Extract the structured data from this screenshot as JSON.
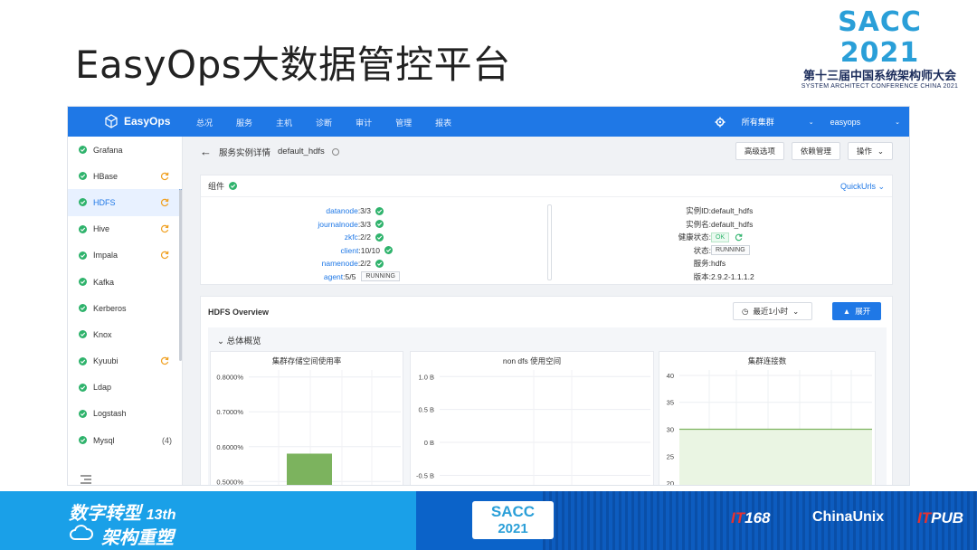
{
  "slide": {
    "title": "EasyOps大数据管控平台",
    "sacc_logo": {
      "main": "SACC 2021",
      "cn": "第十三届中国系统架构师大会",
      "en": "SYSTEM ARCHITECT CONFERENCE CHINA 2021"
    }
  },
  "topbar": {
    "brand": "EasyOps",
    "nav": [
      "总况",
      "服务",
      "主机",
      "诊断",
      "审计",
      "管理",
      "报表"
    ],
    "cluster_select": "所有集群",
    "user": "easyops",
    "color": "#1f78e6"
  },
  "sidebar": {
    "items": [
      {
        "label": "Grafana",
        "sync": false,
        "count": ""
      },
      {
        "label": "HBase",
        "sync": true,
        "count": ""
      },
      {
        "label": "HDFS",
        "sync": true,
        "count": "",
        "active": true
      },
      {
        "label": "Hive",
        "sync": true,
        "count": ""
      },
      {
        "label": "Impala",
        "sync": true,
        "count": ""
      },
      {
        "label": "Kafka",
        "sync": false,
        "count": ""
      },
      {
        "label": "Kerberos",
        "sync": false,
        "count": ""
      },
      {
        "label": "Knox",
        "sync": false,
        "count": ""
      },
      {
        "label": "Kyuubi",
        "sync": true,
        "count": ""
      },
      {
        "label": "Ldap",
        "sync": false,
        "count": ""
      },
      {
        "label": "Logstash",
        "sync": false,
        "count": ""
      },
      {
        "label": "Mysql",
        "sync": false,
        "count": "(4)"
      }
    ]
  },
  "header": {
    "breadcrumb_label": "服务实例详情",
    "instance": "default_hdfs",
    "buttons": {
      "advanced": "高级选项",
      "deps": "依赖管理",
      "ops": "操作"
    }
  },
  "components": {
    "title": "组件",
    "quickurls": "QuickUrls",
    "items": [
      {
        "name": "datanode",
        "value": ":3/3",
        "tag": ""
      },
      {
        "name": "journalnode",
        "value": ":3/3",
        "tag": ""
      },
      {
        "name": "zkfc",
        "value": ":2/2",
        "tag": ""
      },
      {
        "name": "client",
        "value": ":10/10",
        "tag": ""
      },
      {
        "name": "namenode",
        "value": ":2/2",
        "tag": ""
      },
      {
        "name": "agent",
        "value": ":5/5",
        "tag": "RUNNING"
      }
    ]
  },
  "instance_info": {
    "id_label": "实例ID:",
    "id_value": "default_hdfs",
    "name_label": "实例名:",
    "name_value": "default_hdfs",
    "health_label": "健康状态:",
    "health_value": "OK",
    "state_label": "状态:",
    "state_value": "RUNNING",
    "service_label": "服务:",
    "service_value": "hdfs",
    "version_label": "版本:",
    "version_value": "2.9.2-1.1.1.2"
  },
  "overview": {
    "title": "HDFS Overview",
    "time_range": "最近1小时",
    "expand": "展开",
    "summary": "总体概览"
  },
  "chart_data": [
    {
      "type": "bar",
      "title": "集群存储空间使用率",
      "ticks": [
        "0.8000%",
        "0.7000%",
        "0.6000%",
        "0.5000%"
      ],
      "ylim_visible": [
        0.48,
        0.82
      ],
      "categories": [
        ""
      ],
      "values": [
        0.58
      ],
      "color": "#7cb35e"
    },
    {
      "type": "line",
      "title": "non dfs 使用空间",
      "ticks": [
        "1.0 B",
        "0.5 B",
        "0 B",
        "-0.5 B"
      ],
      "ylim_visible": [
        -0.7,
        1.1
      ],
      "series": []
    },
    {
      "type": "area",
      "title": "集群连接数",
      "ticks": [
        "40",
        "35",
        "30",
        "25",
        "20"
      ],
      "ylim_visible": [
        19,
        41
      ],
      "series": [
        {
          "values": [
            30,
            30,
            30,
            30,
            30,
            30,
            30
          ]
        }
      ],
      "color": "#7cb35e"
    }
  ],
  "banner": {
    "slogan_line1": "数字转型",
    "slogan_num": "13th",
    "slogan_line2": "架构重塑",
    "sacc_a": "SACC",
    "sacc_b": "2021",
    "partners": [
      "IT168",
      "ChinaUnix",
      "ITPUB"
    ]
  }
}
